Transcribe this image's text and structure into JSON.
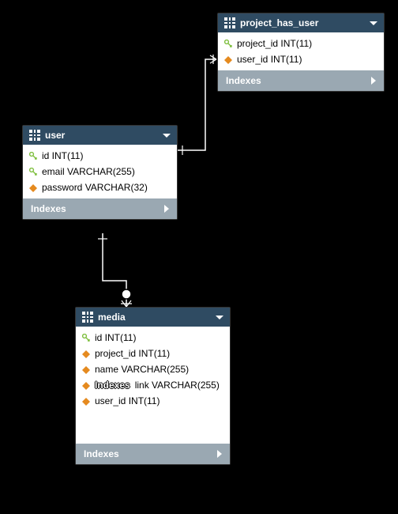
{
  "tables": {
    "project_has_user": {
      "title": "project_has_user",
      "columns": [
        {
          "icon": "key",
          "name": "project_id INT(11)"
        },
        {
          "icon": "diamond",
          "name": "user_id INT(11)"
        }
      ],
      "indexes_label": "Indexes"
    },
    "user": {
      "title": "user",
      "columns": [
        {
          "icon": "key",
          "name": "id INT(11)"
        },
        {
          "icon": "key",
          "name": "email VARCHAR(255)"
        },
        {
          "icon": "diamond",
          "name": "password VARCHAR(32)"
        }
      ],
      "indexes_label": "Indexes"
    },
    "media": {
      "title": "media",
      "columns": [
        {
          "icon": "key",
          "name": "id INT(11)"
        },
        {
          "icon": "diamond",
          "name": "project_id INT(11)"
        },
        {
          "icon": "diamond",
          "name": "name VARCHAR(255)"
        },
        {
          "icon": "diamond",
          "name": "link VARCHAR(255)"
        },
        {
          "icon": "diamond",
          "name": "user_id INT(11)"
        }
      ],
      "indexes_inline": "Indexes",
      "indexes_label": "Indexes"
    }
  },
  "chart_data": {
    "type": "table",
    "description": "Database schema (ER diagram) with three tables and relationships",
    "entities": [
      {
        "name": "project_has_user",
        "columns": [
          {
            "name": "project_id",
            "type": "INT(11)",
            "key": "PK"
          },
          {
            "name": "user_id",
            "type": "INT(11)",
            "key": "FK"
          }
        ]
      },
      {
        "name": "user",
        "columns": [
          {
            "name": "id",
            "type": "INT(11)",
            "key": "PK"
          },
          {
            "name": "email",
            "type": "VARCHAR(255)",
            "key": "UNIQUE"
          },
          {
            "name": "password",
            "type": "VARCHAR(32)"
          }
        ]
      },
      {
        "name": "media",
        "columns": [
          {
            "name": "id",
            "type": "INT(11)",
            "key": "PK"
          },
          {
            "name": "project_id",
            "type": "INT(11)",
            "key": "FK"
          },
          {
            "name": "name",
            "type": "VARCHAR(255)"
          },
          {
            "name": "link",
            "type": "VARCHAR(255)"
          },
          {
            "name": "user_id",
            "type": "INT(11)",
            "key": "FK"
          }
        ]
      }
    ],
    "relationships": [
      {
        "from": "user",
        "to": "project_has_user",
        "type": "one-to-many"
      },
      {
        "from": "user",
        "to": "media",
        "type": "one-to-many"
      }
    ]
  }
}
